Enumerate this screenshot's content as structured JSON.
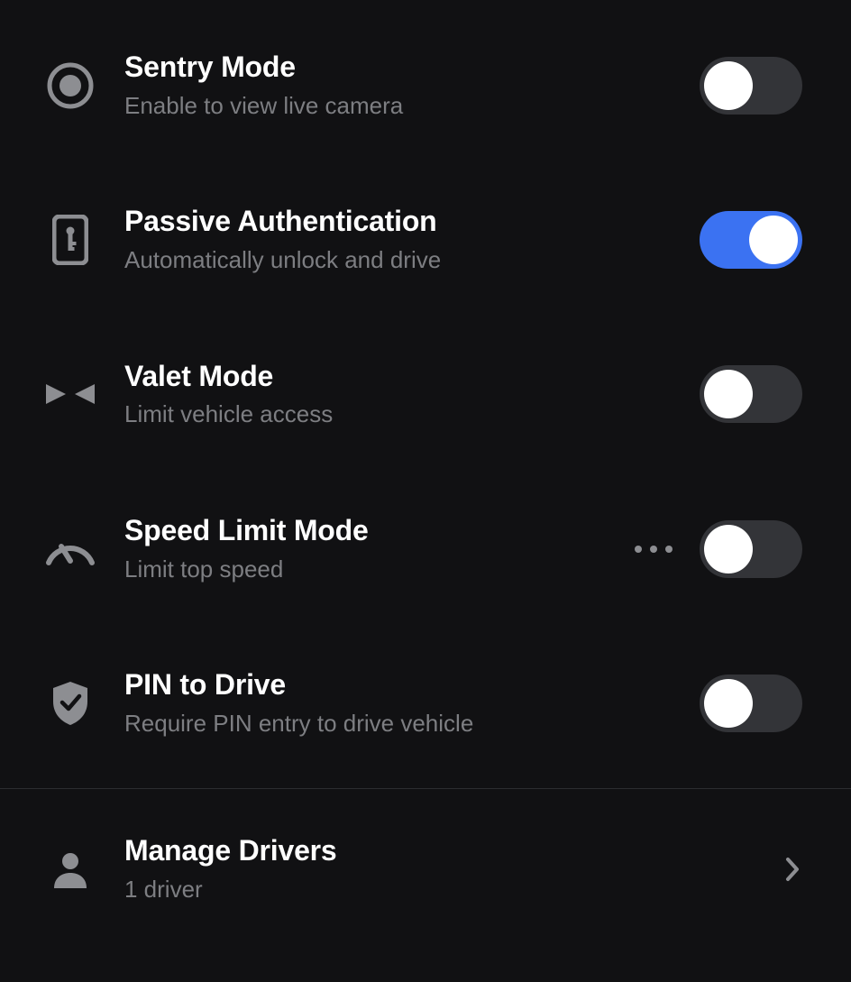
{
  "security": {
    "sentry": {
      "title": "Sentry Mode",
      "subtitle": "Enable to view live camera",
      "on": false
    },
    "passive_auth": {
      "title": "Passive Authentication",
      "subtitle": "Automatically unlock and drive",
      "on": true
    },
    "valet": {
      "title": "Valet Mode",
      "subtitle": "Limit vehicle access",
      "on": false
    },
    "speed_limit": {
      "title": "Speed Limit Mode",
      "subtitle": "Limit top speed",
      "on": false,
      "has_more": true
    },
    "pin_to_drive": {
      "title": "PIN to Drive",
      "subtitle": "Require PIN entry to drive vehicle",
      "on": false
    }
  },
  "manage_drivers": {
    "title": "Manage Drivers",
    "subtitle": "1 driver"
  },
  "colors": {
    "accent": "#3b72f2",
    "icon": "#8d8e92",
    "text_secondary": "#7d7e82",
    "toggle_off_bg": "#333438",
    "bg": "#111113"
  }
}
